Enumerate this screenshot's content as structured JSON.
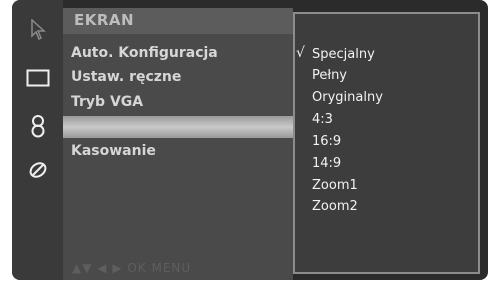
{
  "header": {
    "title": "EKRAN"
  },
  "menu": {
    "items": [
      {
        "label": "Auto. Konfiguracja"
      },
      {
        "label": "Ustaw. ręczne"
      },
      {
        "label": "Tryb VGA"
      },
      {
        "label": ""
      },
      {
        "label": "Kasowanie"
      }
    ]
  },
  "footer": {
    "nav": "▲▼ ◀ ▶ OK MENU"
  },
  "submenu": {
    "selected_mark": "√",
    "items": [
      {
        "label": "Specjalny"
      },
      {
        "label": "Pełny"
      },
      {
        "label": "Oryginalny"
      },
      {
        "label": "4:3"
      },
      {
        "label": "16:9"
      },
      {
        "label": "14:9"
      },
      {
        "label": "Zoom1"
      },
      {
        "label": "Zoom2"
      }
    ]
  },
  "icons": [
    "cursor-arrow-icon",
    "screen-rectangle-icon",
    "speaker-icon",
    "satellite-dish-icon"
  ]
}
